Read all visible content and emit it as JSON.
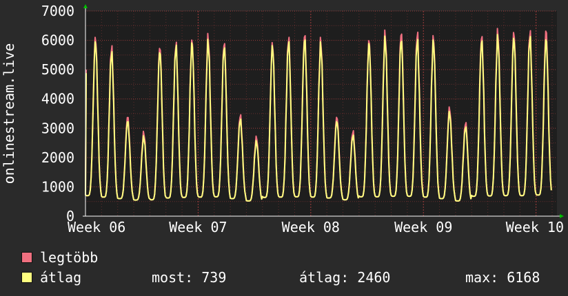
{
  "chart_data": {
    "type": "line",
    "ylabel": "onlinestream.live",
    "ylim": [
      0,
      7000
    ],
    "yticks": [
      0,
      1000,
      2000,
      3000,
      4000,
      5000,
      6000,
      7000
    ],
    "x_tick_labels": [
      "Week 06",
      "Week 07",
      "Week 08",
      "Week 09",
      "Week 10"
    ],
    "x_range_days": [
      0,
      29.3
    ],
    "grid": true,
    "series": [
      {
        "name": "legtöbb",
        "color": "#f07080",
        "daily_peaks": [
          6100,
          5800,
          3400,
          2850,
          5800,
          5900,
          6000,
          6150,
          5950,
          3450,
          2700,
          5900,
          6100,
          6200,
          6000,
          3400,
          2900,
          6000,
          6250,
          6300,
          6250,
          6100,
          3700,
          3200,
          6150,
          6300,
          6300,
          6300,
          6350
        ],
        "daily_troughs": [
          700,
          650,
          600,
          550,
          560,
          620,
          640,
          650,
          660,
          600,
          520,
          640,
          650,
          660,
          650,
          620,
          560,
          660,
          660,
          680,
          680,
          650,
          600,
          520,
          680,
          690,
          700,
          700,
          720
        ]
      },
      {
        "name": "átlag",
        "color": "#ffff80",
        "daily_peaks": [
          5950,
          5600,
          3250,
          2700,
          5650,
          5800,
          5900,
          5950,
          5800,
          3300,
          2550,
          5800,
          5950,
          6050,
          5850,
          3250,
          2750,
          5900,
          6050,
          6050,
          6000,
          5950,
          3550,
          3050,
          6000,
          6100,
          6100,
          6100,
          6050
        ],
        "daily_troughs": [
          700,
          650,
          600,
          550,
          560,
          620,
          640,
          650,
          660,
          600,
          520,
          640,
          650,
          660,
          650,
          620,
          560,
          660,
          660,
          680,
          680,
          650,
          600,
          520,
          680,
          690,
          700,
          700,
          720
        ]
      }
    ]
  },
  "legend": {
    "max_label": "legtöbb",
    "avg_label": "átlag",
    "now_label": "most: 739",
    "avg_stat_label": "átlag: 2460",
    "max_stat_label": "max: 6168"
  },
  "colors": {
    "background": "#2a2a2a",
    "plot_background": "#1e1e1e",
    "grid": "#b04040",
    "max_color": "#f07080",
    "avg_color": "#ffff80",
    "arrow": "#00c000"
  }
}
